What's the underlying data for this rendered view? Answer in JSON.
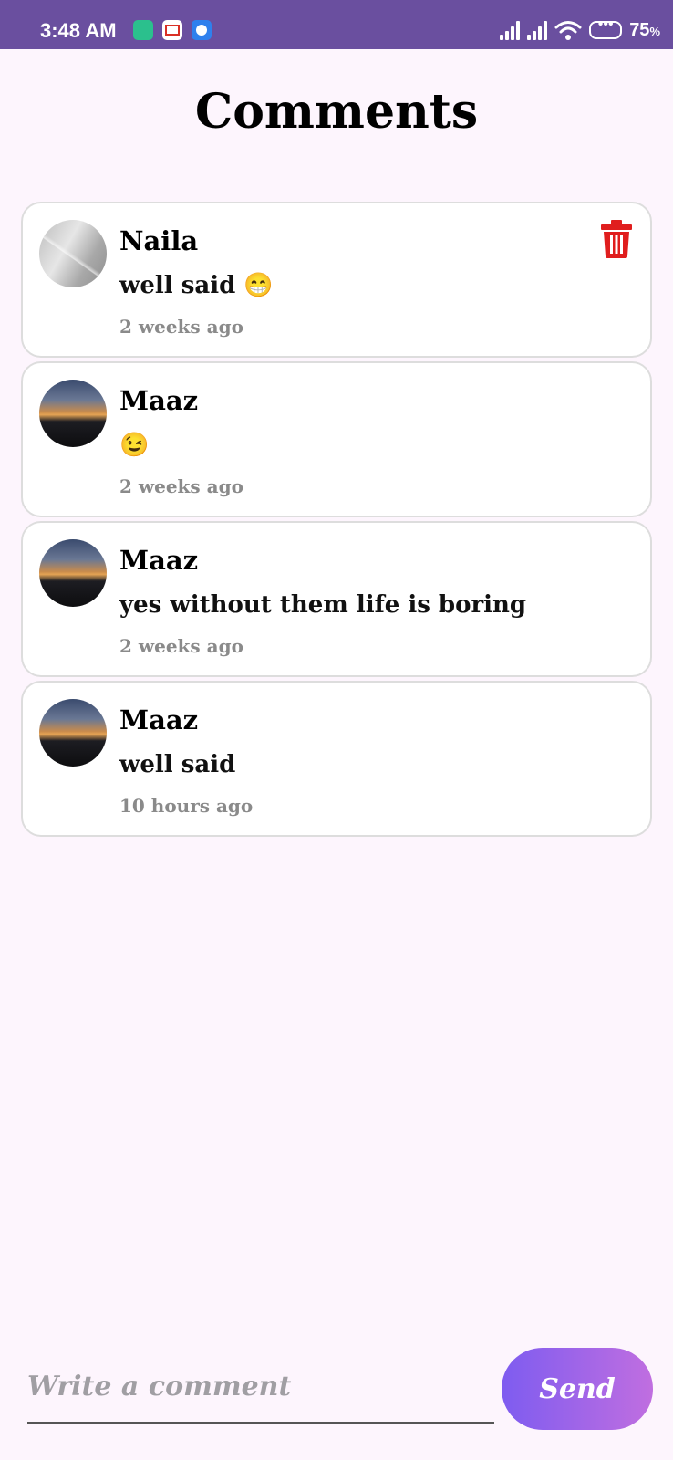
{
  "status_bar": {
    "time": "3:48 AM",
    "battery": "75",
    "battery_unit": "%"
  },
  "page": {
    "title": "Comments"
  },
  "comments": [
    {
      "name": "Naila",
      "text": "well said 😁",
      "time": "2 weeks ago",
      "avatar": "floor-photo-avatar",
      "deletable": true
    },
    {
      "name": "Maaz",
      "text": "😉",
      "time": "2 weeks ago",
      "avatar": "sunset-photo-avatar",
      "deletable": false
    },
    {
      "name": "Maaz",
      "text": "yes without them life is boring",
      "time": "2 weeks ago",
      "avatar": "sunset-photo-avatar",
      "deletable": false
    },
    {
      "name": "Maaz",
      "text": "well said",
      "time": "10 hours ago",
      "avatar": "sunset-photo-avatar",
      "deletable": false
    }
  ],
  "composer": {
    "placeholder": "Write a comment",
    "value": "",
    "send_label": "Send"
  },
  "colors": {
    "status_bar": "#6a4f9f",
    "background": "#fdf5fd",
    "delete": "#e01e1e",
    "send_gradient_start": "#7e5cf0",
    "send_gradient_end": "#c06ee0"
  }
}
